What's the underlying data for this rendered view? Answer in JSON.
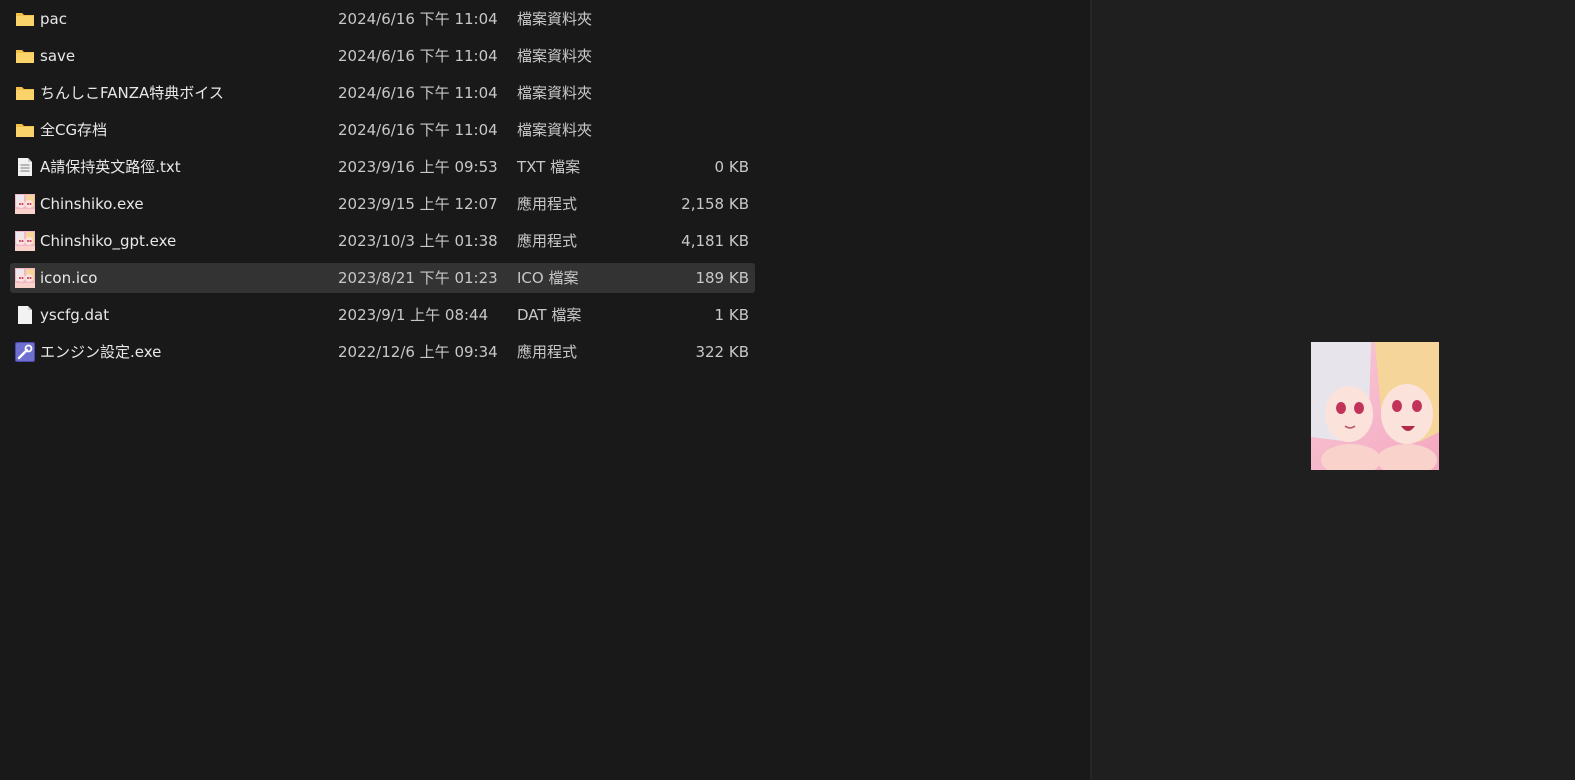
{
  "files": [
    {
      "name": "pac",
      "date": "2024/6/16 下午 11:04",
      "type": "檔案資料夾",
      "size": "",
      "icon": "folder-icon"
    },
    {
      "name": "save",
      "date": "2024/6/16 下午 11:04",
      "type": "檔案資料夾",
      "size": "",
      "icon": "folder-icon"
    },
    {
      "name": "ちんしこFANZA特典ボイス",
      "date": "2024/6/16 下午 11:04",
      "type": "檔案資料夾",
      "size": "",
      "icon": "folder-icon"
    },
    {
      "name": "全CG存档",
      "date": "2024/6/16 下午 11:04",
      "type": "檔案資料夾",
      "size": "",
      "icon": "folder-icon"
    },
    {
      "name": "A請保持英文路徑.txt",
      "date": "2023/9/16 上午 09:53",
      "type": "TXT 檔案",
      "size": "0 KB",
      "icon": "text-file-icon"
    },
    {
      "name": "Chinshiko.exe",
      "date": "2023/9/15 上午 12:07",
      "type": "應用程式",
      "size": "2,158 KB",
      "icon": "app-icon"
    },
    {
      "name": "Chinshiko_gpt.exe",
      "date": "2023/10/3 上午 01:38",
      "type": "應用程式",
      "size": "4,181 KB",
      "icon": "app-icon"
    },
    {
      "name": "icon.ico",
      "date": "2023/8/21 下午 01:23",
      "type": "ICO 檔案",
      "size": "189 KB",
      "icon": "image-file-icon"
    },
    {
      "name": "yscfg.dat",
      "date": "2023/9/1 上午 08:44",
      "type": "DAT 檔案",
      "size": "1 KB",
      "icon": "blank-file-icon"
    },
    {
      "name": "エンジン設定.exe",
      "date": "2022/12/6 上午 09:34",
      "type": "應用程式",
      "size": "322 KB",
      "icon": "settings-app-icon"
    }
  ],
  "selected_index": 7,
  "colors": {
    "background": "#191919",
    "preview_background": "#1f1f1f",
    "selected_row": "#333333",
    "folder": "#f5c04a"
  },
  "preview": {
    "icon": "image-preview-thumbnail"
  }
}
